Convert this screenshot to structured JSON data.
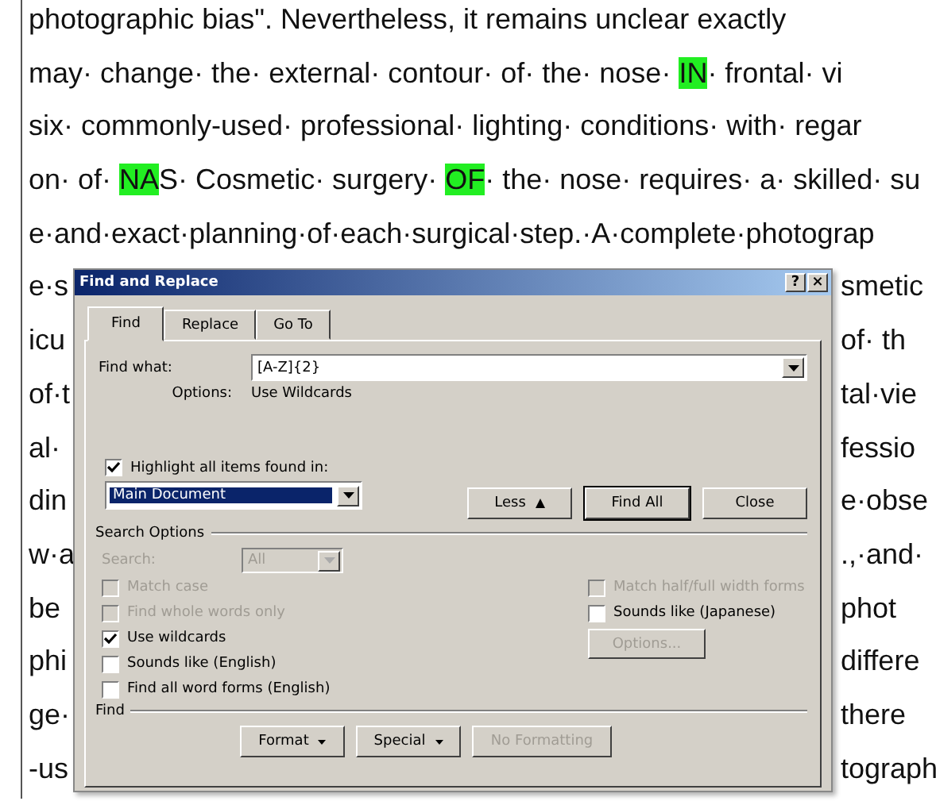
{
  "document": {
    "lines": [
      {
        "segments": [
          {
            "text": "photographic bias\". Nevertheless, it remains unclear exactly",
            "highlighted": false
          }
        ]
      },
      {
        "segments": [
          {
            "text": "may· change· the· external· contour· of· the· nose· ",
            "highlighted": false
          },
          {
            "text": "IN",
            "highlighted": true
          },
          {
            "text": "· frontal· vi",
            "highlighted": false
          }
        ]
      },
      {
        "segments": [
          {
            "text": "six· commonly-used· professional· lighting· conditions· with· regar",
            "highlighted": false
          }
        ]
      },
      {
        "segments": [
          {
            "text": "on· of· ",
            "highlighted": false
          },
          {
            "text": "NA",
            "highlighted": true
          },
          {
            "text": "S· Cosmetic· surgery· ",
            "highlighted": false
          },
          {
            "text": "OF",
            "highlighted": true
          },
          {
            "text": "· the· nose· requires· a· skilled· su",
            "highlighted": false
          }
        ]
      },
      {
        "segments": [
          {
            "text": "e·and·exact·planning·of·each·surgical·step.·A·complete·photograp",
            "highlighted": false
          }
        ]
      }
    ],
    "covered_lines": [
      {
        "left": "e·s",
        "right": "smetic"
      },
      {
        "left": "icu",
        "right": "of· th"
      },
      {
        "left": "of·t",
        "right": "tal·vie"
      },
      {
        "left": "al·",
        "right": "fessio"
      },
      {
        "left": "din",
        "right": "e·obse"
      },
      {
        "left": "w·a",
        "right": ".,·and·"
      },
      {
        "left": "be",
        "right": "phot"
      },
      {
        "left": "phi",
        "right": "differe"
      },
      {
        "left": "ge·",
        "right": "there"
      },
      {
        "left": "-us",
        "right": "tograph"
      }
    ]
  },
  "dialog": {
    "title": "Find and Replace",
    "help": "?",
    "close": "×",
    "tabs": [
      {
        "label": "Find",
        "selected": true
      },
      {
        "label": "Replace",
        "selected": false
      },
      {
        "label": "Go To",
        "selected": false
      }
    ],
    "find_what": {
      "label": "Find what:",
      "value": "[A-Z]{2}"
    },
    "options": {
      "label": "Options:",
      "value": "Use Wildcards"
    },
    "highlight": {
      "label": "Highlight all items found in:",
      "checked": true
    },
    "highlight_scope": {
      "value": "Main Document",
      "selected": true
    },
    "action_buttons": [
      {
        "label": "Less",
        "kind": "less",
        "default": false
      },
      {
        "label": "Find All",
        "kind": "plain",
        "default": true
      },
      {
        "label": "Close",
        "kind": "plain",
        "default": false
      }
    ],
    "search_options": {
      "title": "Search Options",
      "search": {
        "label": "Search:",
        "value": "All",
        "disabled": true
      },
      "left_checks": [
        {
          "label": "Match case",
          "checked": false,
          "disabled": true
        },
        {
          "label": "Find whole words only",
          "checked": false,
          "disabled": true
        },
        {
          "label": "Use wildcards",
          "checked": true,
          "disabled": false
        },
        {
          "label": "Sounds like (English)",
          "checked": false,
          "disabled": false
        },
        {
          "label": "Find all word forms (English)",
          "checked": false,
          "disabled": false
        }
      ],
      "right_checks": [
        {
          "label": "Match half/full width forms",
          "checked": false,
          "disabled": true
        },
        {
          "label": "Sounds like (Japanese)",
          "checked": false,
          "disabled": false
        }
      ],
      "options_button": {
        "label": "Options...",
        "disabled": true
      }
    },
    "find_section": {
      "title": "Find",
      "buttons": [
        {
          "label": "Format",
          "dropdown": true,
          "disabled": false
        },
        {
          "label": "Special",
          "dropdown": true,
          "disabled": false
        },
        {
          "label": "No Formatting",
          "dropdown": false,
          "disabled": true
        }
      ]
    }
  }
}
